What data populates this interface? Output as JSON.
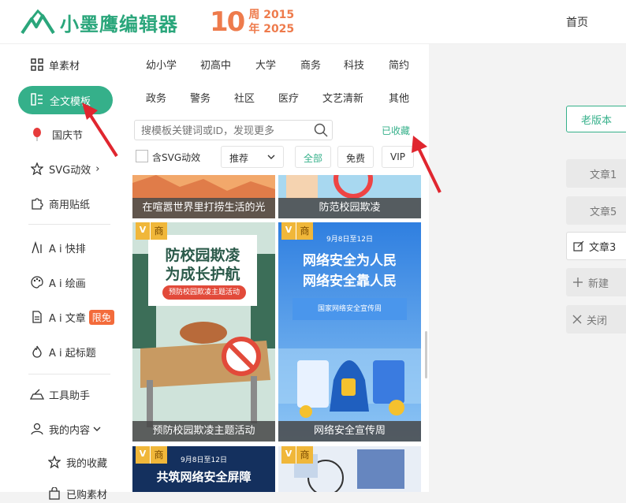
{
  "header": {
    "logo_text": "小墨鹰编辑器",
    "anniversary_number": "10",
    "anniversary_line1": "周 2015",
    "anniversary_line2": "年 2025",
    "home_label": "首页"
  },
  "sidebar": {
    "items": [
      {
        "label": "单素材"
      },
      {
        "label": "全文模板"
      },
      {
        "label": "国庆节"
      },
      {
        "label": "SVG动效"
      },
      {
        "label": "商用贴纸"
      },
      {
        "label": "A i 快排"
      },
      {
        "label": "A i 绘画"
      },
      {
        "label": "A i 文章"
      },
      {
        "label": "A i 起标题"
      },
      {
        "label": "工具助手"
      },
      {
        "label": "我的内容"
      },
      {
        "label": "我的收藏"
      },
      {
        "label": "已购素材"
      }
    ],
    "limited_badge": "限免",
    "svg_chevron": "›"
  },
  "categories": {
    "row1": [
      "幼小学",
      "初高中",
      "大学",
      "商务",
      "科技",
      "简约"
    ],
    "row2": [
      "政务",
      "警务",
      "社区",
      "医疗",
      "文艺清新",
      "其他"
    ]
  },
  "search": {
    "placeholder": "搜模板关键词或ID，发现更多",
    "favorites_link": "已收藏"
  },
  "filters": {
    "svg_checkbox_label": "含SVG动效",
    "sort_selected": "推荐",
    "pills": [
      "全部",
      "免费",
      "VIP"
    ]
  },
  "cards": [
    {
      "caption": "在喧嚣世界里打捞生活的光"
    },
    {
      "caption": "防范校园欺凌"
    },
    {
      "caption": "预防校园欺凌主题活动",
      "poster_title_1": "防校园欺凌",
      "poster_title_2": "为成长护航",
      "poster_sub": "预防校园欺凌主题活动"
    },
    {
      "caption": "网络安全宣传周",
      "poster_date": "9月8日至12日",
      "poster_title_1": "网络安全为人民",
      "poster_title_2": "网络安全靠人民",
      "poster_sub": "国家网络安全宣传周"
    },
    {
      "caption": "",
      "poster_date": "9月8日至12日",
      "poster_title_1": "共筑网络安全屏障"
    },
    {
      "caption": ""
    }
  ],
  "card_tags": {
    "v": "V",
    "shang": "商"
  },
  "right_panel": {
    "old_version": "老版本",
    "articles": [
      "文章1",
      "文章5",
      "文章3"
    ],
    "new_label": "新建",
    "close_label": "关闭"
  },
  "colors": {
    "brand_green": "#35b08a",
    "accent_orange": "#ee7b4c",
    "badge_red": "#f36b3b"
  }
}
